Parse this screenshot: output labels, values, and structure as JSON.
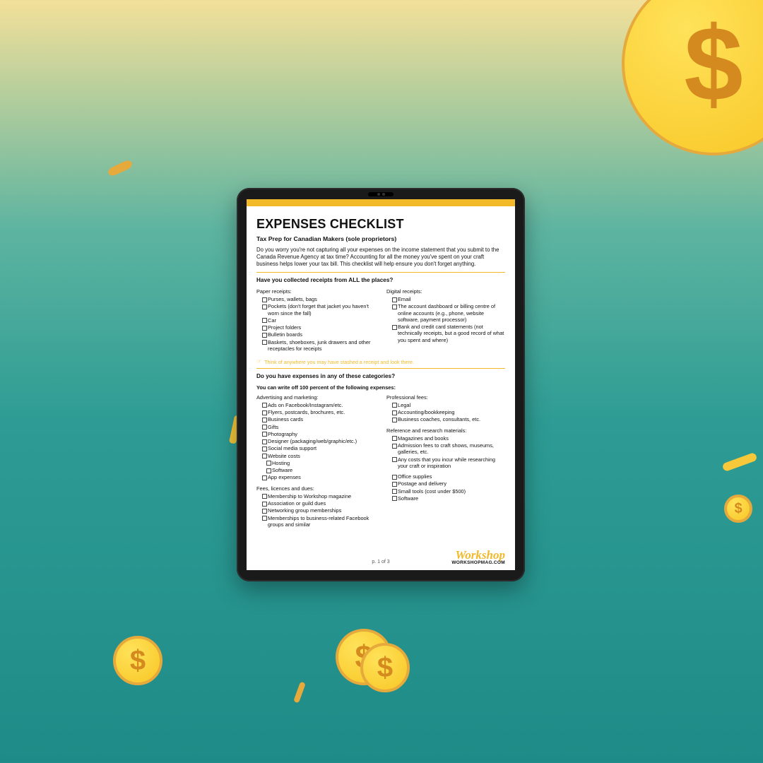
{
  "document": {
    "title": "EXPENSES CHECKLIST",
    "subtitle": "Tax Prep for Canadian Makers (sole proprietors)",
    "intro": "Do you worry you're not capturing all your expenses on the income statement that you submit to the Canada Revenue Agency at tax time? Accounting for all the money you've spent on your craft business helps lower your tax bill. This checklist will help ensure you don't forget anything.",
    "section1": {
      "question": "Have you collected receipts from ALL the places?",
      "left_title": "Paper receipts:",
      "left_items": [
        "Purses, wallets, bags",
        "Pockets (don't forget that jacket you haven't worn since the fall)",
        "Car",
        "Project folders",
        "Bulletin boards",
        "Baskets, shoeboxes, junk drawers and other receptacles for receipts"
      ],
      "right_title": "Digital receipts:",
      "right_items": [
        "Email",
        "The account dashboard or billing centre of online accounts (e.g., phone, website software, payment processor)",
        "Bank and credit card statements (not technically receipts, but a good record of what you spent and where)"
      ],
      "tip": "Think of anywhere you may have stashed a receipt and look there."
    },
    "section2": {
      "question": "Do you have expenses in any of these categories?",
      "note": "You can write off 100 percent of the following expenses:",
      "left": {
        "g1_title": "Advertising and marketing:",
        "g1_items": [
          "Ads on Facebook/Instagram/etc.",
          "Flyers, postcards, brochures, etc.",
          "Business cards",
          "Gifts",
          "Photography",
          "Designer (packaging/web/graphic/etc.)",
          "Social media support",
          "Website costs"
        ],
        "g1_sub": [
          "Hosting",
          "Software"
        ],
        "g1_items2": [
          "App expenses"
        ],
        "g2_title": "Fees, licences and dues:",
        "g2_items": [
          "Membership to Workshop magazine",
          "Association or guild dues",
          "Networking group memberships",
          "Memberships to business-related Facebook groups and similar"
        ]
      },
      "right": {
        "g1_title": "Professional fees:",
        "g1_items": [
          "Legal",
          "Accounting/bookkeeping",
          "Business coaches, consultants, etc."
        ],
        "g2_title": "Reference and research materials:",
        "g2_items": [
          "Magazines and books",
          "Admission fees to craft shows, museums, galleries, etc.",
          "Any costs that you incur while researching your craft or inspiration"
        ],
        "g3_items": [
          "Office supplies",
          "Postage and delivery",
          "Small tools (cost under $500)",
          "Software"
        ]
      }
    },
    "page": "p. 1 of 3",
    "brand": "Workshop",
    "brand_url": "WORKSHOPMAG.COM"
  }
}
